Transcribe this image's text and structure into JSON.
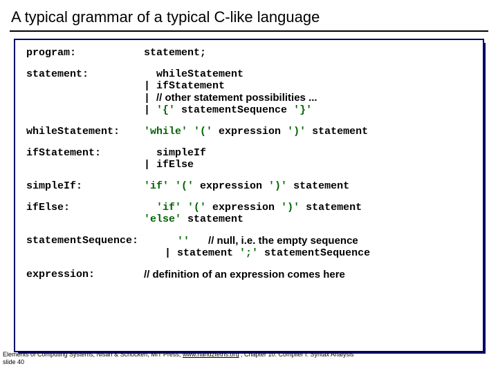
{
  "title": "A typical grammar of a typical C-like language",
  "rules": {
    "program": {
      "label": "program:",
      "body": "statement;"
    },
    "statement": {
      "label": "statement:",
      "l1": "  whileStatement",
      "l2": "| ifStatement",
      "l3_prefix": "| ",
      "l3_comment": "// other statement possibilities ...",
      "l4a": "| ",
      "l4b": "'{'",
      "l4c": " statementSequence ",
      "l4d": "'}'"
    },
    "whileStatement": {
      "label": "whileStatement:",
      "kw": "'while' '('",
      "mid": " expression ",
      "close": "')'",
      "tail": " statement"
    },
    "ifStatement": {
      "label": "ifStatement:",
      "l1": "  simpleIf",
      "l2": "| ifElse"
    },
    "simpleIf": {
      "label": "simpleIf:",
      "kw1": "'if' '('",
      "mid": " expression ",
      "kw2": "')'",
      "tail": " statement"
    },
    "ifElse": {
      "label": "ifElse:",
      "kw1": "'if' '('",
      "mid": " expression ",
      "kw2": "')'",
      "tail1": " statement",
      "kw3": "'else'",
      "tail2": " statement"
    },
    "statementSequence": {
      "label": "statementSequence:",
      "l1a": "  ",
      "l1b": "''",
      "l1c": "   ",
      "l1_comment": "// null, i.e. the empty sequence",
      "l2a": "| statement ",
      "l2b": "';'",
      "l2c": " statementSequence"
    },
    "expression": {
      "label": "expression:",
      "comment": "// definition of an expression comes here"
    }
  },
  "footer": {
    "line1a": "Elements of Computing Systems, Nisan & Schocken, MIT Press, ",
    "link": "www.nand2tetris.org",
    "line1b": " , Chapter 10: Compiler I: Syntax Analysis",
    "line2": "slide 40"
  }
}
